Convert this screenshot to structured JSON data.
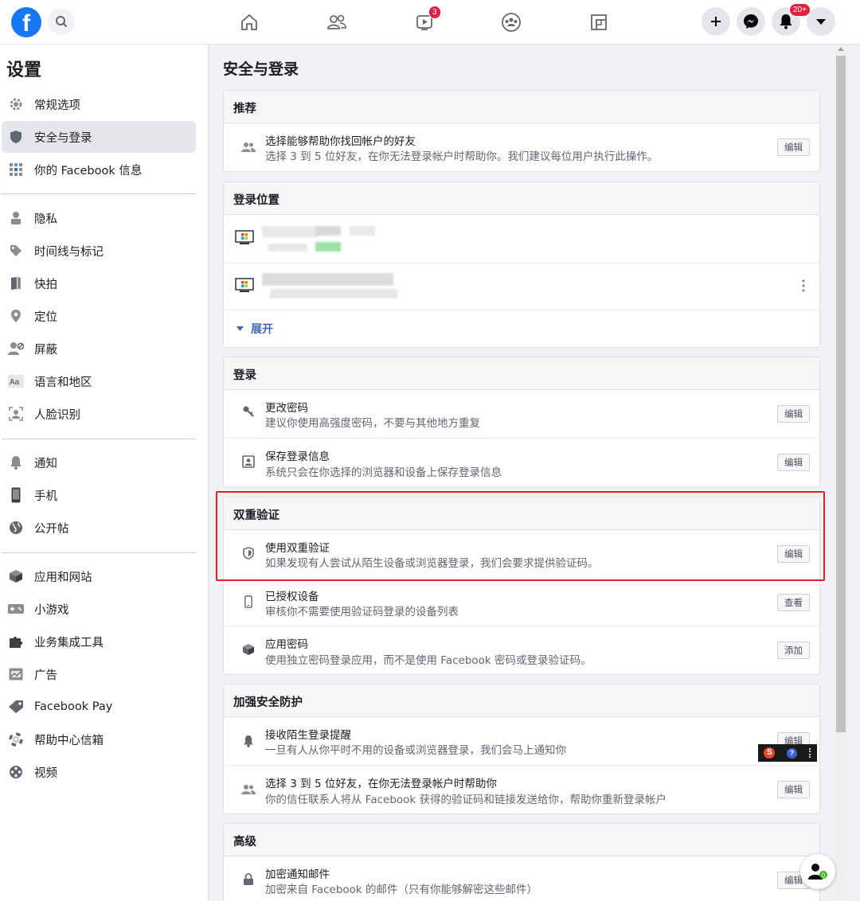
{
  "topbar": {
    "logo": "f",
    "video_badge": "3",
    "notif_badge": "20+"
  },
  "sidebar": {
    "title": "设置",
    "items": [
      {
        "label": "常规选项",
        "icon": "gear-icon"
      },
      {
        "label": "安全与登录",
        "icon": "shield-icon",
        "active": true
      },
      {
        "label": "你的 Facebook 信息",
        "icon": "grid-icon"
      },
      {
        "label": "隐私",
        "icon": "lock-person-icon"
      },
      {
        "label": "时间线与标记",
        "icon": "tag-icon"
      },
      {
        "label": "快拍",
        "icon": "book-icon"
      },
      {
        "label": "定位",
        "icon": "location-pin-icon"
      },
      {
        "label": "屏蔽",
        "icon": "block-user-icon"
      },
      {
        "label": "语言和地区",
        "icon": "language-icon"
      },
      {
        "label": "人脸识别",
        "icon": "face-icon"
      },
      {
        "label": "通知",
        "icon": "bell-icon"
      },
      {
        "label": "手机",
        "icon": "phone-icon"
      },
      {
        "label": "公开帖",
        "icon": "globe-icon"
      },
      {
        "label": "应用和网站",
        "icon": "cube-icon"
      },
      {
        "label": "小游戏",
        "icon": "gamepad-icon"
      },
      {
        "label": "业务集成工具",
        "icon": "puzzle-icon"
      },
      {
        "label": "广告",
        "icon": "ad-icon"
      },
      {
        "label": "Facebook Pay",
        "icon": "tag-pay-icon"
      },
      {
        "label": "帮助中心信箱",
        "icon": "lifebuoy-icon"
      },
      {
        "label": "视频",
        "icon": "film-icon"
      }
    ]
  },
  "main": {
    "title": "安全与登录",
    "recommended": {
      "heading": "推荐",
      "title": "选择能够帮助你找回帐户的好友",
      "sub": "选择 3 到 5 位好友，在你无法登录帐户时帮助你。我们建议每位用户执行此操作。",
      "button": "编辑"
    },
    "locations": {
      "heading": "登录位置",
      "expand": "展开"
    },
    "login": {
      "heading": "登录",
      "rows": [
        {
          "title": "更改密码",
          "sub": "建议你使用高强度密码，不要与其他地方重复",
          "button": "编辑"
        },
        {
          "title": "保存登录信息",
          "sub": "系统只会在你选择的浏览器和设备上保存登录信息",
          "button": "编辑"
        }
      ]
    },
    "two_factor": {
      "heading": "双重验证",
      "rows": [
        {
          "title": "使用双重验证",
          "sub": "如果发现有人尝试从陌生设备或浏览器登录，我们会要求提供验证码。",
          "button": "编辑"
        },
        {
          "title": "已授权设备",
          "sub": "审核你不需要使用验证码登录的设备列表",
          "button": "查看"
        },
        {
          "title": "应用密码",
          "sub": "使用独立密码登录应用，而不是使用 Facebook 密码或登录验证码。",
          "button": "添加"
        }
      ]
    },
    "extra_security": {
      "heading": "加强安全防护",
      "rows": [
        {
          "title": "接收陌生登录提醒",
          "sub": "一旦有人从你平时不用的设备或浏览器登录，我们会马上通知你",
          "button": "编辑"
        },
        {
          "title": "选择 3 到 5 位好友，在你无法登录帐户时帮助你",
          "sub": "你的信任联系人将从 Facebook 获得的验证码和链接发送给你，帮助你重新登录帐户",
          "button": "编辑"
        }
      ]
    },
    "advanced": {
      "heading": "高级",
      "rows": [
        {
          "title": "加密通知邮件",
          "sub": "加密来自 Facebook 的邮件（只有你能够解密这些邮件）",
          "button": "编辑"
        }
      ]
    }
  },
  "colors": {
    "accent": "#1877f2",
    "highlight": "#e02020",
    "badge": "#e41e3f"
  }
}
